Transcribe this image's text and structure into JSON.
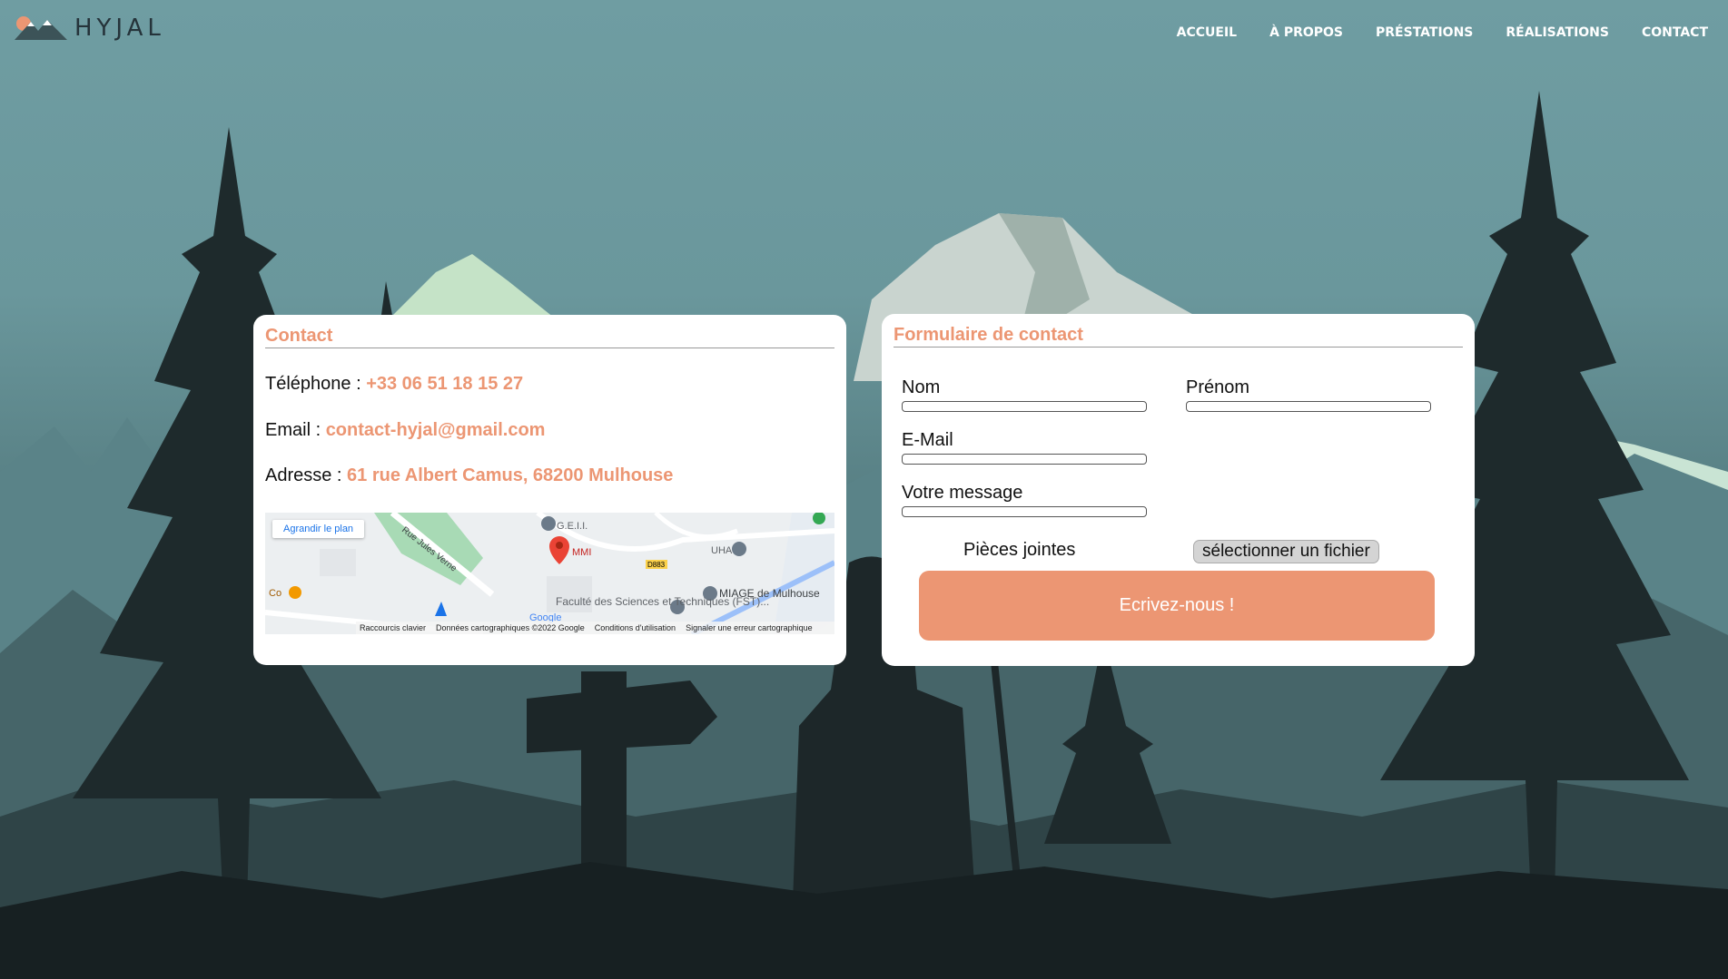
{
  "brand": {
    "name": "HYJAL",
    "colors": {
      "accent": "#ec9673",
      "nav_text": "#ffffff"
    }
  },
  "nav": {
    "items": [
      "ACCUEIL",
      "À PROPOS",
      "PRÉSTATIONS",
      "RÉALISATIONS",
      "CONTACT"
    ]
  },
  "contact": {
    "title": "Contact",
    "phone": {
      "label": "Téléphone : ",
      "value": "+33 06 51 18 15 27"
    },
    "email": {
      "label": "Email : ",
      "value": "contact-hyjal@gmail.com"
    },
    "address": {
      "label": "Adresse : ",
      "value": "61 rue Albert Camus, 68200 Mulhouse"
    },
    "map": {
      "enlarge": "Agrandir le plan",
      "labels": [
        "G.E.I.I.",
        "MMI",
        "UHA",
        "MIAGE de Mulhouse",
        "Faculté des Sciences et Techniques (FST)...",
        "Rue Jules Verne",
        "D883",
        "Co"
      ],
      "footer": [
        "Raccourcis clavier",
        "Données cartographiques ©2022 Google",
        "Conditions d'utilisation",
        "Signaler une erreur cartographique"
      ],
      "google": "Google"
    }
  },
  "form": {
    "title": "Formulaire de contact",
    "nom": "Nom",
    "prenom": "Prénom",
    "email": "E-Mail",
    "message": "Votre message",
    "attachments": "Pièces jointes",
    "file_button": "sélectionner un fichier",
    "submit": "Ecrivez-nous !"
  }
}
